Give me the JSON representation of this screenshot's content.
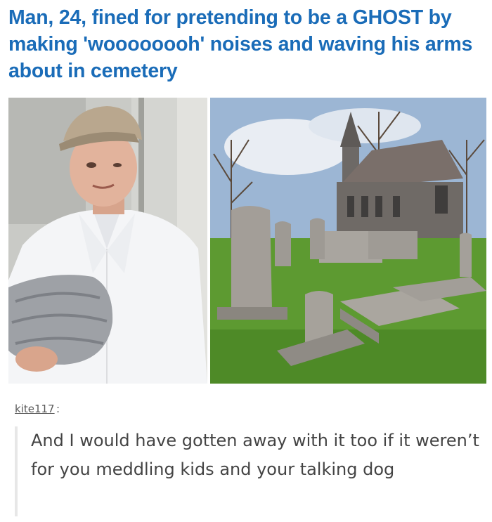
{
  "article": {
    "headline": "Man, 24, fined for pretending to be a GHOST by making 'woooooooh' noises and waving his arms about in cemetery",
    "headline_color": "#1a6cb8"
  },
  "photos": {
    "left_alt": "man in white shirt holding grey jumper",
    "right_alt": "cemetery with gravestones and chapel"
  },
  "post": {
    "username": "kite117",
    "colon": ":",
    "quote": "And I would have gotten away with it too if it weren’t for you meddling kids and your talking dog"
  }
}
